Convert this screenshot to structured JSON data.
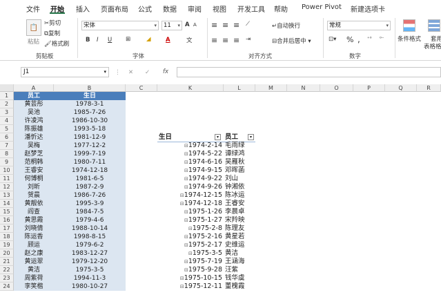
{
  "menu": {
    "tabs": [
      "文件",
      "开始",
      "插入",
      "页面布局",
      "公式",
      "数据",
      "审阅",
      "视图",
      "开发工具",
      "帮助",
      "Power Pivot",
      "新建选项卡"
    ],
    "active": "开始"
  },
  "ribbon": {
    "clipboard": {
      "paste": "粘贴",
      "cut": "剪切",
      "copy": "复制",
      "format_painter": "格式刷",
      "label": "剪贴板"
    },
    "font": {
      "name": "宋体",
      "size": "11",
      "bold": "B",
      "italic": "I",
      "underline": "U",
      "grow": "A",
      "shrink": "A",
      "fontcolor": "A",
      "phonetic": "文",
      "label": "字体"
    },
    "align": {
      "wrap": "自动换行",
      "merge": "合并后居中",
      "label": "对齐方式"
    },
    "number": {
      "format": "常规",
      "percent": "%",
      "comma": ",",
      "label": "数字"
    },
    "styles": {
      "cond": "条件格式",
      "table": "套用",
      "table2": "表格格"
    }
  },
  "formula": {
    "namebox": "J1",
    "fx": "fx",
    "cancel": "✕",
    "enter": "✓"
  },
  "columns": [
    "A",
    "B",
    "C",
    "K",
    "L",
    "M",
    "N",
    "O",
    "P",
    "Q",
    "R"
  ],
  "rows": [
    "1",
    "2",
    "3",
    "4",
    "5",
    "6",
    "7",
    "8",
    "9",
    "10",
    "11",
    "12",
    "13",
    "14",
    "15",
    "16",
    "17",
    "18",
    "19",
    "20",
    "21",
    "22",
    "23",
    "24"
  ],
  "table": {
    "headers": [
      "员工",
      "生日"
    ],
    "rows": [
      [
        "黄芸彤",
        "1978-3-1"
      ],
      [
        "吴池",
        "1985-7-26"
      ],
      [
        "许凌鸿",
        "1986-10-30"
      ],
      [
        "陈振雄",
        "1993-5-18"
      ],
      [
        "潘忻达",
        "1981-12-9"
      ],
      [
        "吴梅",
        "1977-12-2"
      ],
      [
        "赵梦芝",
        "1999-7-19"
      ],
      [
        "范桐韩",
        "1980-7-11"
      ],
      [
        "王睿安",
        "1974-12-18"
      ],
      [
        "何博桐",
        "1981-6-5"
      ],
      [
        "刘昕",
        "1987-2-9"
      ],
      [
        "贺晨",
        "1986-7-26"
      ],
      [
        "黄靓依",
        "1995-3-9"
      ],
      [
        "阎查",
        "1984-7-5"
      ],
      [
        "黄思霞",
        "1979-4-6"
      ],
      [
        "刘晓倩",
        "1988-10-14"
      ],
      [
        "陈运香",
        "1998-8-15"
      ],
      [
        "顾运",
        "1979-6-2"
      ],
      [
        "赵之康",
        "1983-12-27"
      ],
      [
        "黄运翠",
        "1979-12-20"
      ],
      [
        "黄洁",
        "1975-3-5"
      ],
      [
        "周紫荷",
        "1994-11-3"
      ],
      [
        "李笑楷",
        "1980-10-27"
      ]
    ]
  },
  "pivot": {
    "headers": [
      "生日",
      "员工"
    ],
    "rows": [
      [
        "1974-2-14",
        "毛雨绿"
      ],
      [
        "1974-5-22",
        "谭绿鸿"
      ],
      [
        "1974-6-16",
        "吴雁秋"
      ],
      [
        "1974-9-15",
        "邓晖菡"
      ],
      [
        "1974-9-22",
        "刘山"
      ],
      [
        "1974-9-26",
        "钟湘依"
      ],
      [
        "1974-12-15",
        "陈冰运"
      ],
      [
        "1974-12-18",
        "王睿安"
      ],
      [
        "1975-1-26",
        "李晨卓"
      ],
      [
        "1975-1-27",
        "宋羚映"
      ],
      [
        "1975-2-8",
        "陈理友"
      ],
      [
        "1975-2-16",
        "黄星若"
      ],
      [
        "1975-2-17",
        "史维运"
      ],
      [
        "1975-3-5",
        "黄洁"
      ],
      [
        "1975-7-19",
        "王涵海"
      ],
      [
        "1975-9-28",
        "汪紫"
      ],
      [
        "1975-10-15",
        "钱华虞"
      ],
      [
        "1975-12-11",
        "董槐霞"
      ]
    ]
  }
}
